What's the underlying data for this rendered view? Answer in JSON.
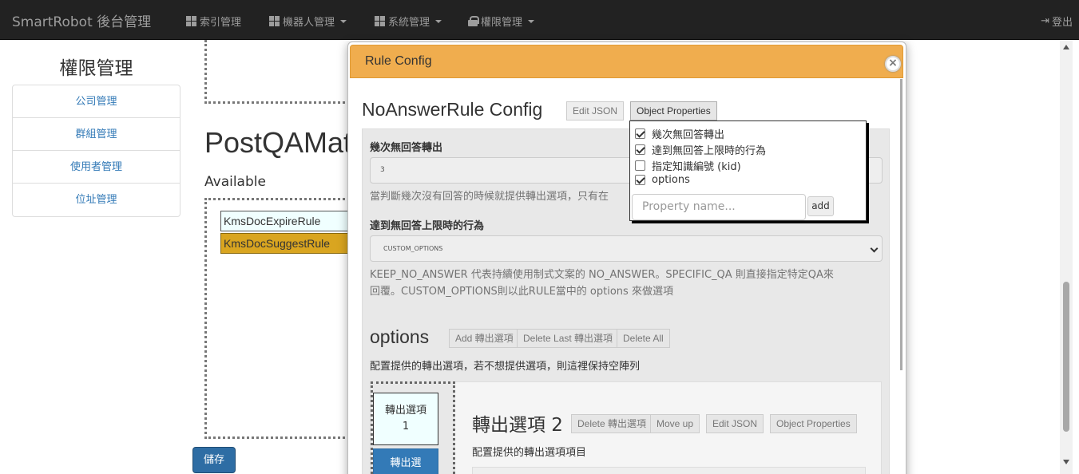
{
  "navbar": {
    "brand": "SmartRobot 後台管理",
    "items": [
      {
        "label": "索引管理",
        "icon": "grid-icon",
        "dropdown": false
      },
      {
        "label": "機器人管理",
        "icon": "grid-icon",
        "dropdown": true
      },
      {
        "label": "系統管理",
        "icon": "grid-icon",
        "dropdown": true
      },
      {
        "label": "權限管理",
        "icon": "lock-icon",
        "dropdown": true
      }
    ],
    "logout": "登出"
  },
  "sidebar": {
    "title": "權限管理",
    "items": [
      {
        "label": "公司管理"
      },
      {
        "label": "群組管理"
      },
      {
        "label": "使用者管理"
      },
      {
        "label": "位址管理"
      }
    ]
  },
  "main": {
    "title": "PostQAMat",
    "available_label": "Available",
    "rules": [
      "KmsDocExpireRule",
      "KmsDocSuggestRule"
    ],
    "save_label": "儲存"
  },
  "modal": {
    "header": "Rule Config",
    "close": "×",
    "config_title": "NoAnswerRule Config",
    "edit_json": "Edit JSON",
    "object_properties": "Object Properties",
    "field1": {
      "label": "幾次無回答轉出",
      "value": "3",
      "help": "當判斷幾次沒有回答的時候就提供轉出選項，只有在"
    },
    "field2": {
      "label": "達到無回答上限時的行為",
      "value": "CUSTOM_OPTIONS",
      "help_line1": "KEEP_NO_ANSWER 代表持續使用制式文案的 NO_ANSWER。SPECIFIC_QA 則直接指定特定QA來",
      "help_line2": "回覆。CUSTOM_OPTIONS則以此RULE當中的 options 來做選項"
    },
    "options": {
      "title": "options",
      "add": "Add 轉出選項",
      "delete_last": "Delete Last 轉出選項",
      "delete_all": "Delete All",
      "help": "配置提供的轉出選項，若不想提供選項，則這裡保持空陣列",
      "tabs": [
        "轉出選項 1",
        "轉出選"
      ],
      "sub": {
        "title": "轉出選項 2",
        "delete": "Delete 轉出選項",
        "move_up": "Move up",
        "edit_json": "Edit JSON",
        "object_properties": "Object Properties",
        "help": "配置提供的轉出選項項目"
      }
    }
  },
  "popup": {
    "properties": [
      {
        "label": "幾次無回答轉出",
        "checked": true
      },
      {
        "label": "達到無回答上限時的行為",
        "checked": true
      },
      {
        "label": "指定知識編號 (kid)",
        "checked": false
      },
      {
        "label": "options",
        "checked": true
      }
    ],
    "input_placeholder": "Property name...",
    "add": "add"
  }
}
